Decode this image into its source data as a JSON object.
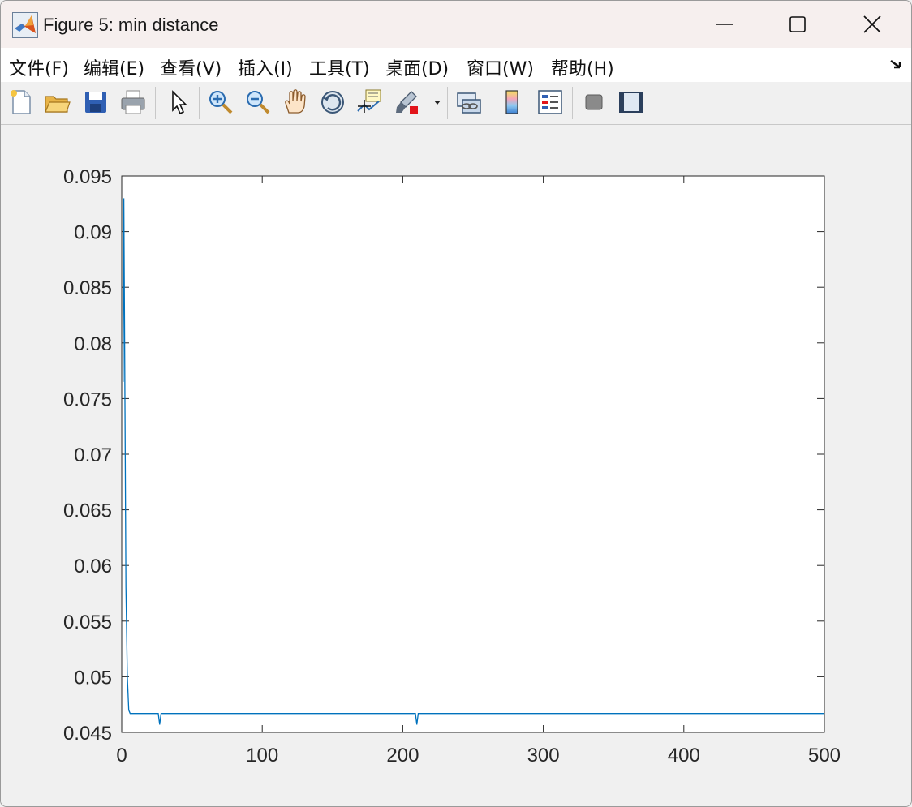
{
  "window": {
    "title": "Figure 5: min distance"
  },
  "menu": {
    "items": [
      {
        "label": "文件(F)"
      },
      {
        "label": "编辑(E)"
      },
      {
        "label": "查看(V)"
      },
      {
        "label": "插入(I)"
      },
      {
        "label": "工具(T)"
      },
      {
        "label": "桌面(D)"
      },
      {
        "label": "窗口(W)"
      },
      {
        "label": "帮助(H)"
      }
    ]
  },
  "toolbar": {
    "buttons": [
      "new-figure-icon",
      "open-file-icon",
      "save-icon",
      "print-icon",
      "edit-plot-arrow-icon",
      "zoom-in-icon",
      "zoom-out-icon",
      "pan-hand-icon",
      "rotate-3d-icon",
      "data-cursor-icon",
      "brush-icon",
      "link-plot-icon",
      "colorbar-icon",
      "legend-icon",
      "hide-plot-tools-icon",
      "show-plot-tools-icon"
    ]
  },
  "chart_data": {
    "type": "line",
    "title": "",
    "xlabel": "",
    "ylabel": "",
    "xlim": [
      0,
      500
    ],
    "ylim": [
      0.045,
      0.095
    ],
    "xticks": [
      "0",
      "100",
      "200",
      "300",
      "400",
      "500"
    ],
    "yticks": [
      "0.045",
      "0.05",
      "0.055",
      "0.06",
      "0.065",
      "0.07",
      "0.075",
      "0.08",
      "0.085",
      "0.09",
      "0.095"
    ],
    "grid": false,
    "line_color": "#0072bd",
    "series": [
      {
        "x": [
          1,
          1.5,
          2,
          3,
          4,
          5,
          6,
          7,
          26,
          27,
          28,
          209,
          210,
          211,
          500
        ],
        "y": [
          0.0765,
          0.093,
          0.082,
          0.058,
          0.05,
          0.047,
          0.0467,
          0.0467,
          0.0467,
          0.0457,
          0.0467,
          0.0467,
          0.0457,
          0.0467,
          0.0467
        ]
      }
    ]
  }
}
